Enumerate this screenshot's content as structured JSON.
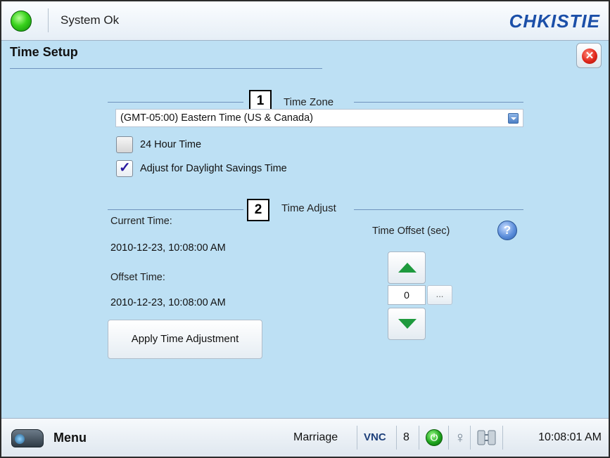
{
  "header": {
    "status_text": "System Ok",
    "logo_text": "CHKISTIE"
  },
  "page": {
    "title": "Time Setup"
  },
  "sections": {
    "time_zone": {
      "marker": "1",
      "label": "Time Zone"
    },
    "time_adjust": {
      "marker": "2",
      "label": "Time Adjust"
    }
  },
  "time_zone": {
    "selected": "(GMT-05:00) Eastern Time (US & Canada)",
    "options": {
      "hour24": {
        "label": "24 Hour Time",
        "checked": false
      },
      "dst": {
        "label": "Adjust for Daylight Savings Time",
        "checked": true
      }
    }
  },
  "time_adjust": {
    "current_label": "Current Time:",
    "current_value": "2010-12-23, 10:08:00 AM",
    "offset_label": "Offset Time:",
    "offset_value": "2010-12-23, 10:08:00 AM",
    "offset_sec_label": "Time Offset (sec)",
    "offset_sec_value": "0",
    "ellipsis": "...",
    "apply_label": "Apply Time Adjustment",
    "help_glyph": "?"
  },
  "footer": {
    "menu_label": "Menu",
    "profile": "Marriage",
    "vnc": "VNC",
    "count": "8",
    "power_glyph": "⏻",
    "lamp_glyph": "♀",
    "clock": "10:08:01 AM"
  },
  "colors": {
    "background": "#bde0f4",
    "accent": "#1b4fa8",
    "status_ok": "#38d21c",
    "arrow_green": "#1e9a3d",
    "close_red": "#e0271b"
  },
  "icons": [
    "status-led-icon",
    "close-icon",
    "chevron-down-icon",
    "check-icon",
    "help-icon",
    "arrow-up-icon",
    "arrow-down-icon",
    "projector-icon",
    "power-icon",
    "lamp-icon",
    "network-icon"
  ]
}
